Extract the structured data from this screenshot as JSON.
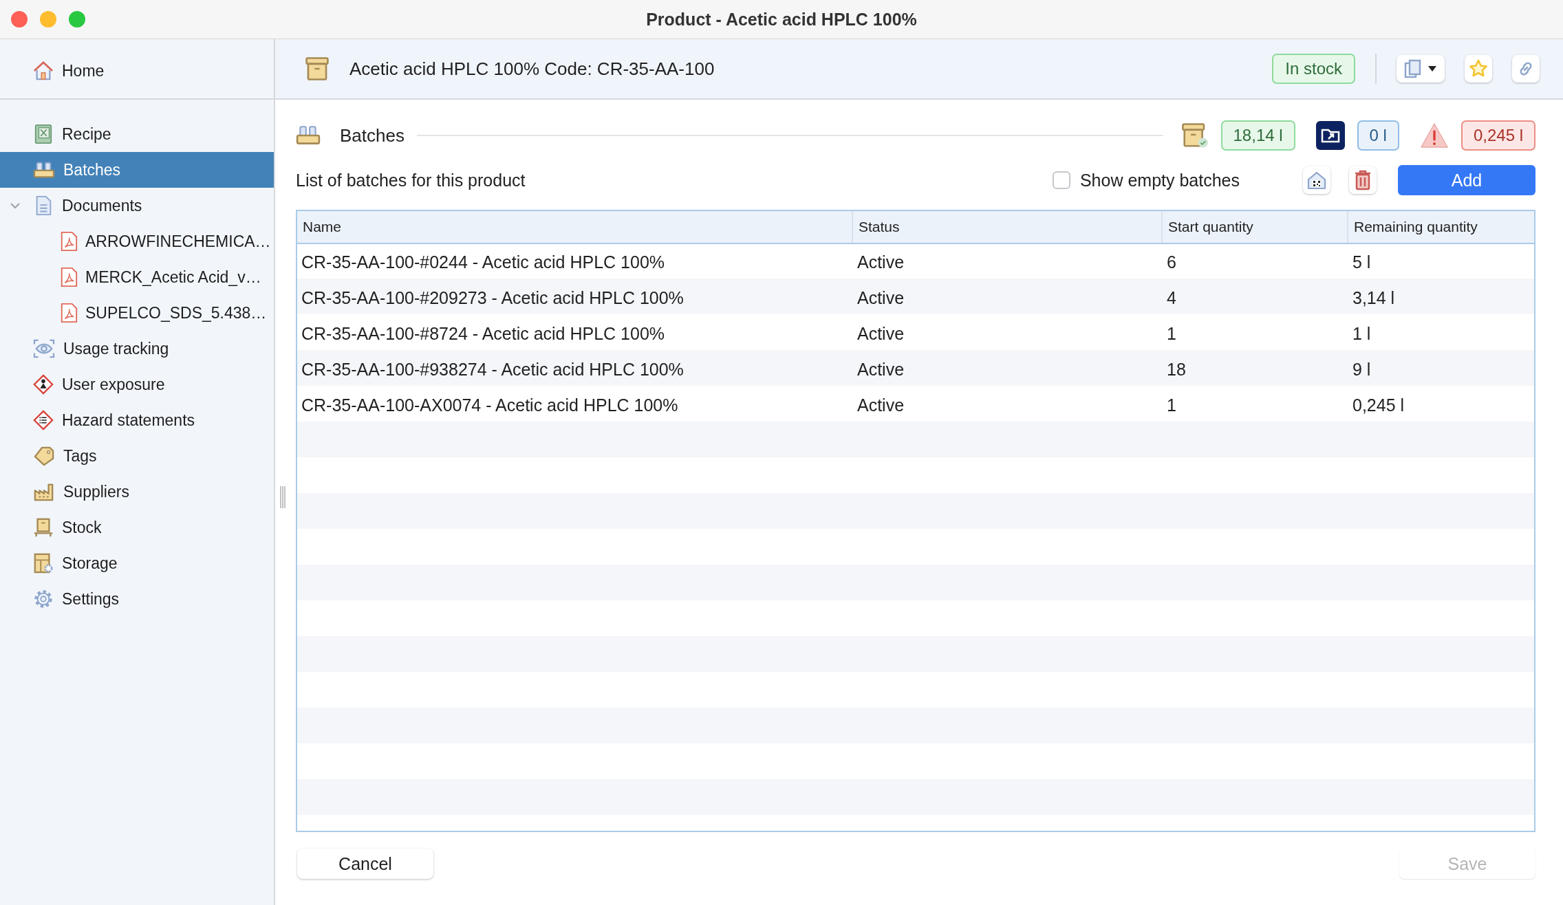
{
  "window": {
    "title": "Product - Acetic acid HPLC 100%"
  },
  "sidebar": {
    "home": {
      "label": "Home"
    },
    "items": [
      {
        "kind": "recipe",
        "label": "Recipe",
        "selected": false
      },
      {
        "kind": "batches",
        "label": "Batches",
        "selected": true
      },
      {
        "kind": "documents",
        "label": "Documents",
        "selected": false,
        "expanded": true,
        "children": [
          {
            "kind": "pdf",
            "label": "ARROWFINECHEMICA…",
            "selected": false
          },
          {
            "kind": "pdf",
            "label": "MERCK_Acetic Acid_v…",
            "selected": false
          },
          {
            "kind": "pdf",
            "label": "SUPELCO_SDS_5.438…",
            "selected": false
          }
        ]
      },
      {
        "kind": "usage",
        "label": "Usage tracking",
        "selected": false
      },
      {
        "kind": "exposure",
        "label": "User exposure",
        "selected": false
      },
      {
        "kind": "hazard",
        "label": "Hazard statements",
        "selected": false
      },
      {
        "kind": "tags",
        "label": "Tags",
        "selected": false
      },
      {
        "kind": "suppliers",
        "label": "Suppliers",
        "selected": false
      },
      {
        "kind": "stock",
        "label": "Stock",
        "selected": false
      },
      {
        "kind": "storage",
        "label": "Storage",
        "selected": false
      },
      {
        "kind": "settings",
        "label": "Settings",
        "selected": false
      }
    ]
  },
  "header": {
    "title": "Acetic acid HPLC 100% Code: CR-35-AA-100",
    "status": "In stock"
  },
  "batches": {
    "title": "Batches",
    "badges": [
      {
        "kind": "in-stock",
        "value": "18,14 l"
      },
      {
        "kind": "moved",
        "value": "0 l"
      },
      {
        "kind": "warning",
        "value": "0,245 l"
      }
    ],
    "description": "List of batches for this product",
    "show_empty": {
      "label": "Show empty batches",
      "checked": false
    },
    "add_label": "Add"
  },
  "table": {
    "columns": [
      "Name",
      "Status",
      "Start quantity",
      "Remaining quantity"
    ],
    "rows": [
      [
        "CR-35-AA-100-#0244 - Acetic acid HPLC 100%",
        "Active",
        "6",
        "5 l"
      ],
      [
        "CR-35-AA-100-#209273 - Acetic acid HPLC 100%",
        "Active",
        "4",
        "3,14 l"
      ],
      [
        "CR-35-AA-100-#8724 - Acetic acid HPLC 100%",
        "Active",
        "1",
        "1 l"
      ],
      [
        "CR-35-AA-100-#938274 - Acetic acid HPLC 100%",
        "Active",
        "18",
        "9 l"
      ],
      [
        "CR-35-AA-100-AX0074 - Acetic acid HPLC 100%",
        "Active",
        "1",
        "0,245 l"
      ]
    ]
  },
  "footer": {
    "cancel": "Cancel",
    "save": {
      "label": "Save",
      "disabled": true
    }
  }
}
